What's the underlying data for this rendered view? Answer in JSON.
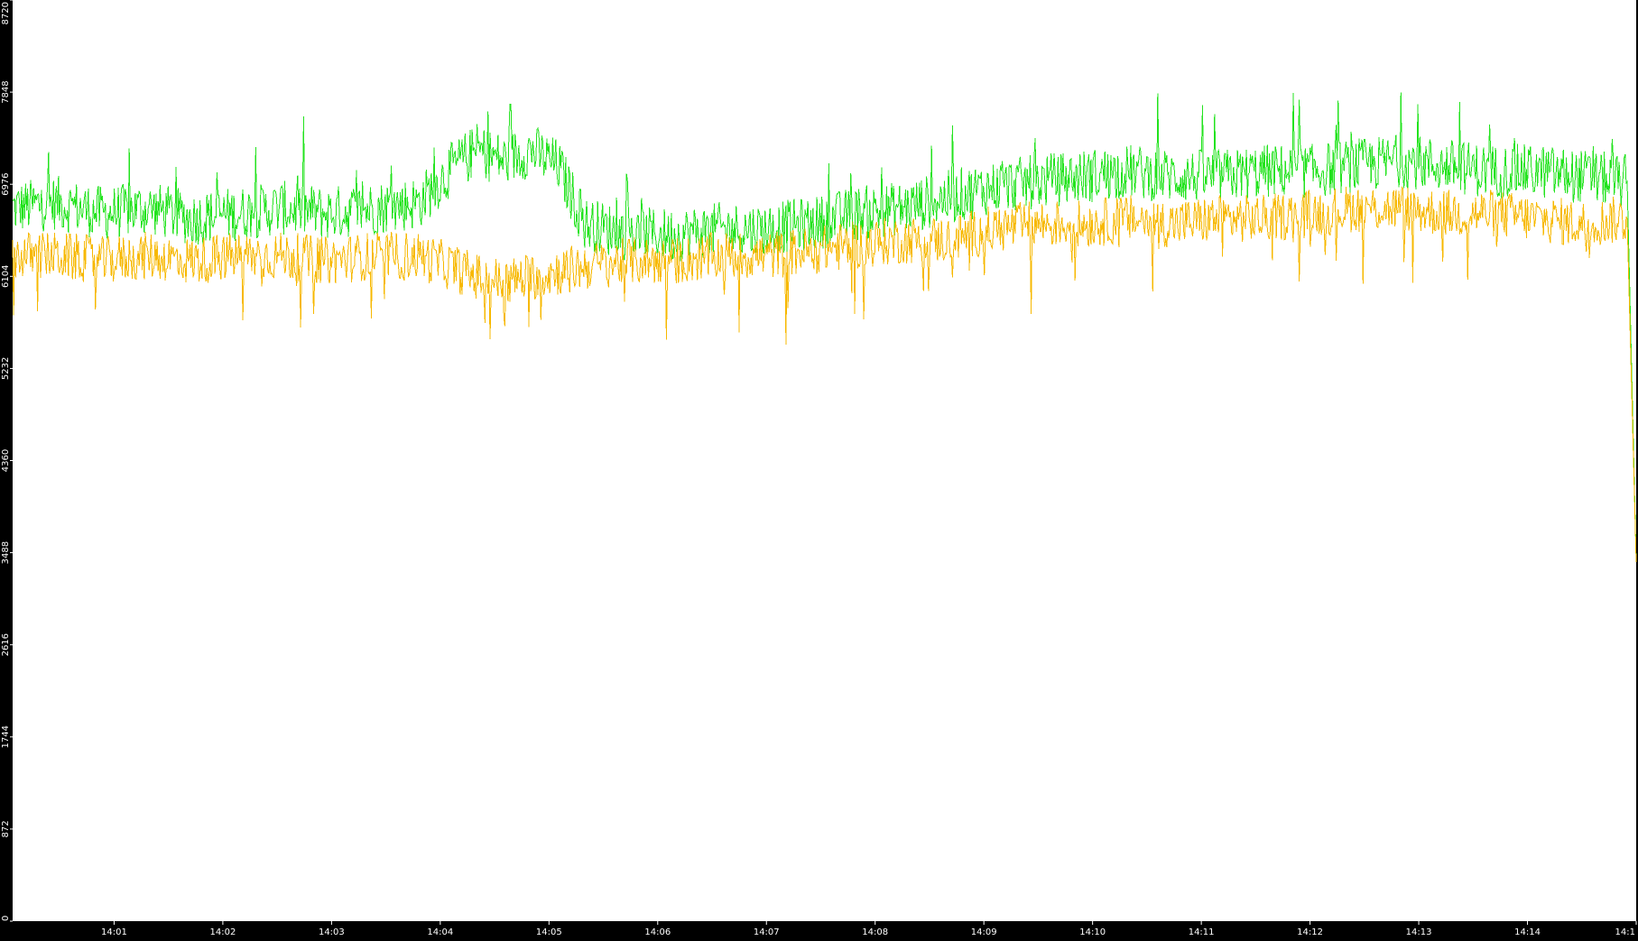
{
  "chart_data": {
    "type": "line",
    "title": "",
    "xlabel": "",
    "ylabel": "",
    "ylim": [
      0,
      8720
    ],
    "y_ticks": [
      "0",
      "872",
      "1744",
      "2616",
      "3488",
      "4360",
      "5232",
      "6104",
      "6976",
      "7848",
      "8720"
    ],
    "x_ticks": [
      "14:01",
      "14:02",
      "14:03",
      "14:04",
      "14:05",
      "14:06",
      "14:07",
      "14:08",
      "14:09",
      "14:10",
      "14:11",
      "14:12",
      "14:13",
      "14:14",
      "14:1"
    ],
    "x_range": [
      "14:00:04",
      "14:15:00"
    ],
    "grid": false,
    "legend": "none",
    "colors": {
      "background": "#000000",
      "plot_background": "#ffffff",
      "series_green": "#22e31d",
      "series_orange": "#f7b800",
      "axis_text": "#ffffff"
    },
    "series": [
      {
        "color": "#22e31d",
        "x": [
          "14:00:04",
          "14:00:28",
          "14:00:54",
          "14:01:19",
          "14:01:43",
          "14:02:08",
          "14:02:33",
          "14:02:58",
          "14:03:23",
          "14:03:48",
          "14:04:05",
          "14:04:20",
          "14:04:35",
          "14:04:50",
          "14:05:05",
          "14:05:20",
          "14:05:45",
          "14:06:10",
          "14:06:35",
          "14:07:00",
          "14:07:25",
          "14:07:50",
          "14:08:15",
          "14:08:40",
          "14:09:05",
          "14:09:30",
          "14:09:55",
          "14:10:20",
          "14:10:45",
          "14:11:10",
          "14:11:35",
          "14:12:00",
          "14:12:25",
          "14:12:50",
          "14:13:15",
          "14:13:40",
          "14:14:05",
          "14:14:30",
          "14:14:55",
          "14:15:00"
        ],
        "y": [
          6750,
          6800,
          6700,
          6750,
          6650,
          6700,
          6750,
          6700,
          6750,
          6800,
          7100,
          7300,
          7200,
          7300,
          7150,
          6600,
          6500,
          6500,
          6550,
          6550,
          6600,
          6700,
          6750,
          6850,
          6950,
          7000,
          7050,
          7100,
          7050,
          7050,
          7100,
          7100,
          7150,
          7200,
          7150,
          7100,
          7100,
          7050,
          7000,
          3400
        ],
        "y_min": 6000,
        "y_max": 8720
      },
      {
        "color": "#f7b800",
        "x": [
          "14:00:04",
          "14:00:28",
          "14:00:54",
          "14:01:19",
          "14:01:43",
          "14:02:08",
          "14:02:33",
          "14:02:58",
          "14:03:23",
          "14:03:48",
          "14:04:05",
          "14:04:20",
          "14:04:35",
          "14:04:50",
          "14:05:05",
          "14:05:20",
          "14:05:45",
          "14:06:10",
          "14:06:35",
          "14:07:00",
          "14:07:25",
          "14:07:50",
          "14:08:15",
          "14:08:40",
          "14:09:05",
          "14:09:30",
          "14:09:55",
          "14:10:20",
          "14:10:45",
          "14:11:10",
          "14:11:35",
          "14:12:00",
          "14:12:25",
          "14:12:50",
          "14:13:15",
          "14:13:40",
          "14:14:05",
          "14:14:30",
          "14:14:55",
          "14:15:00"
        ],
        "y": [
          6300,
          6300,
          6250,
          6300,
          6250,
          6300,
          6300,
          6250,
          6300,
          6300,
          6200,
          6100,
          6050,
          6100,
          6150,
          6200,
          6250,
          6250,
          6300,
          6300,
          6350,
          6400,
          6450,
          6450,
          6550,
          6600,
          6600,
          6650,
          6600,
          6650,
          6650,
          6700,
          6750,
          6750,
          6700,
          6700,
          6650,
          6600,
          6650,
          3400
        ],
        "y_min": 5150,
        "y_max": 7300
      }
    ]
  }
}
